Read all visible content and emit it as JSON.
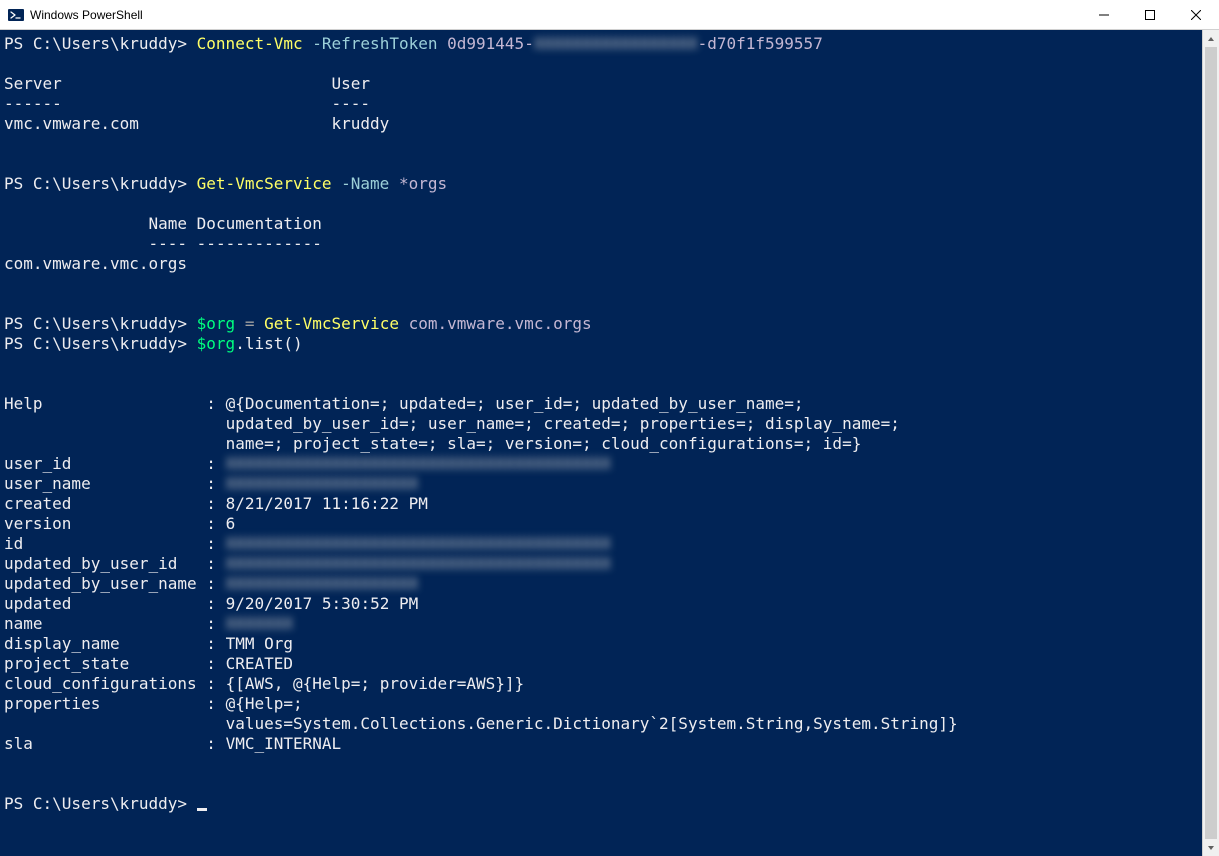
{
  "window": {
    "title": "Windows PowerShell"
  },
  "prompts": {
    "p1": "PS C:\\Users\\kruddy> ",
    "p2": "PS C:\\Users\\kruddy> ",
    "p3": "PS C:\\Users\\kruddy> ",
    "p4": "PS C:\\Users\\kruddy> ",
    "p5": "PS C:\\Users\\kruddy> "
  },
  "cmd1": {
    "name": "Connect-Vmc",
    "param": " -RefreshToken ",
    "arg_prefix": "0d991445-",
    "arg_hidden": "XXXXXXXXXXXXXXXXX",
    "arg_suffix": "-d70f1f599557"
  },
  "out1": {
    "header_server": "Server",
    "header_user": "User",
    "sep_server": "------",
    "sep_user": "----",
    "row_server": "vmc.vmware.com",
    "row_user": "kruddy"
  },
  "cmd2": {
    "name": "Get-VmcService",
    "param": " -Name ",
    "arg": "*orgs"
  },
  "out2": {
    "header_name": "Name",
    "header_doc": "Documentation",
    "sep_name": "----",
    "sep_doc": "-------------",
    "row_name": "com.vmware.vmc.orgs"
  },
  "cmd3": {
    "var": "$org",
    "eq": " = ",
    "name": "Get-VmcService",
    "arg": " com.vmware.vmc.orgs"
  },
  "cmd4": {
    "var": "$org",
    "method": ".list()"
  },
  "out3": {
    "k_help": "Help",
    "v_help1": "@{Documentation=; updated=; user_id=; updated_by_user_name=;",
    "v_help2": "updated_by_user_id=; user_name=; created=; properties=; display_name=;",
    "v_help3": "name=; project_state=; sla=; version=; cloud_configurations=; id=}",
    "k_user_id": "user_id",
    "v_user_id": "XXXXXXXXXXXXXXXXXXXXXXXXXXXXXXXXXXXXXXXX",
    "k_user_name": "user_name",
    "v_user_name": "XXXXXXXXXXXXXXXXXXXX",
    "k_created": "created",
    "v_created": "8/21/2017 11:16:22 PM",
    "k_version": "version",
    "v_version": "6",
    "k_id": "id",
    "v_id": "XXXXXXXXXXXXXXXXXXXXXXXXXXXXXXXXXXXXXXXX",
    "k_updated_by_user_id": "updated_by_user_id",
    "v_updated_by_user_id": "XXXXXXXXXXXXXXXXXXXXXXXXXXXXXXXXXXXXXXXX",
    "k_updated_by_user_name": "updated_by_user_name",
    "v_updated_by_user_name": "XXXXXXXXXXXXXXXXXXXX",
    "k_updated": "updated",
    "v_updated": "9/20/2017 5:30:52 PM",
    "k_name": "name",
    "v_name": "XXXXXXX",
    "k_display_name": "display_name",
    "v_display_name": "TMM Org",
    "k_project_state": "project_state",
    "v_project_state": "CREATED",
    "k_cloud_configurations": "cloud_configurations",
    "v_cloud_configurations": "{[AWS, @{Help=; provider=AWS}]}",
    "k_properties": "properties",
    "v_properties1": "@{Help=;",
    "v_properties2": "values=System.Collections.Generic.Dictionary`2[System.String,System.String]}",
    "k_sla": "sla",
    "v_sla": "VMC_INTERNAL"
  },
  "colon": " : "
}
